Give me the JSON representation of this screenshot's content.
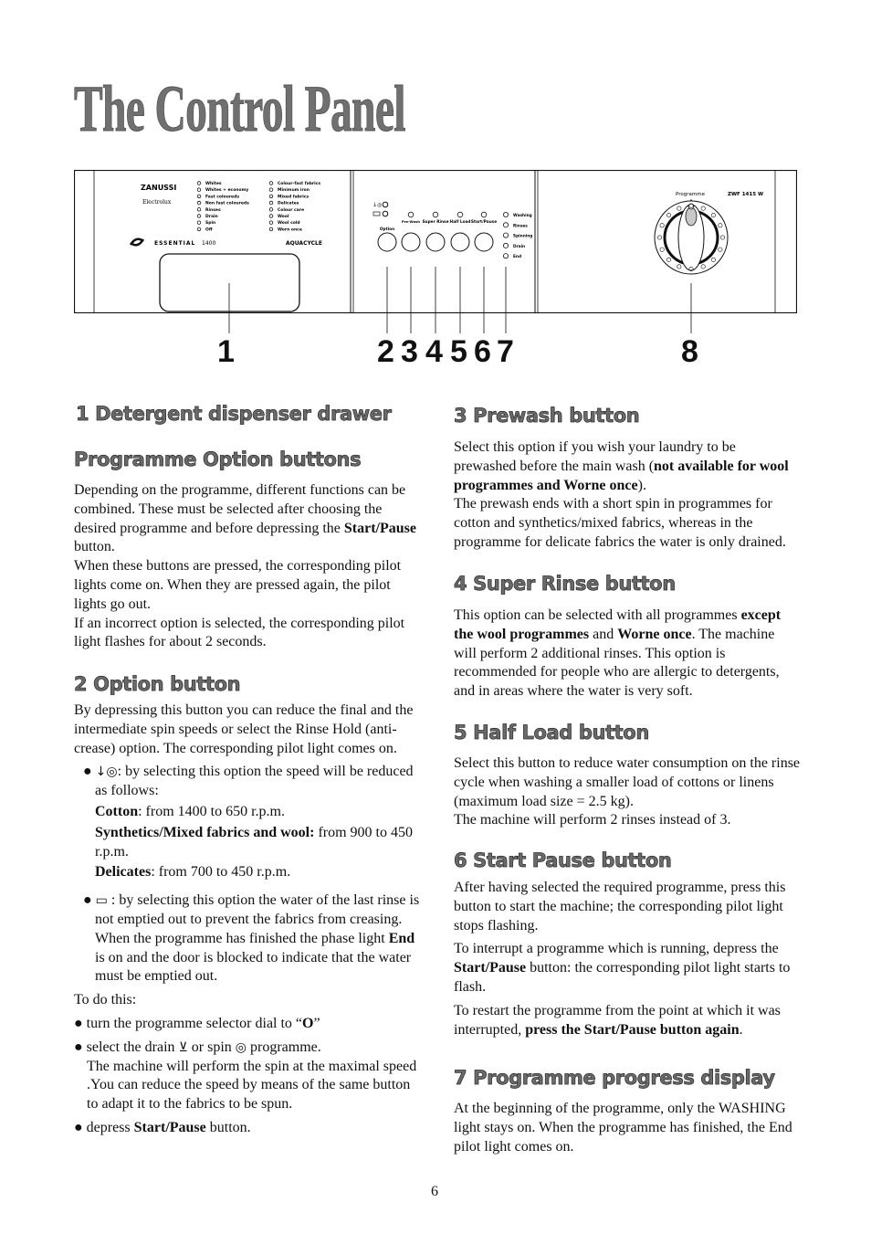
{
  "title": "The Control Panel",
  "panel": {
    "brand": "ZANUSSI",
    "sub_brand": "Electrolux",
    "series": "ESSENTIAL",
    "speed": "1400",
    "aquacycle": "AQUACYCLE",
    "programmes_left": [
      "Whites",
      "Whites + economy",
      "Fast coloureds",
      "Non fast coloureds",
      "Rinses",
      "Drain",
      "Spin",
      "Off"
    ],
    "programmes_right": [
      "Colour-fast fabrics",
      "Minimum iron",
      "Mixed fabrics",
      "Delicates",
      "Colour care",
      "Wool",
      "Wool cold",
      "Worn once"
    ],
    "buttons": [
      "Option",
      "Pre-Wash",
      "Super Rinse",
      "Half Load",
      "Start/Pause"
    ],
    "phases": [
      "Washing",
      "Rinses",
      "Spinning",
      "Drain",
      "End"
    ],
    "dial_label": "Programme",
    "model": "ZWF 1415 W",
    "dial_pointer_color": "#c8c8c8"
  },
  "callouts": [
    "1",
    "2",
    "3",
    "4",
    "5",
    "6",
    "7",
    "8"
  ],
  "left": {
    "h1": "1 Detergent dispenser drawer",
    "h2": "Programme Option buttons",
    "p_options": [
      [
        {
          "t": "Depending on the programme, different functions can be combined. These must be selected after choosing the desired programme and before depressing the "
        },
        {
          "t": "Start/Pause",
          "b": 1
        },
        {
          "t": " button."
        }
      ],
      [
        {
          "t": "When these buttons are pressed, the corresponding pilot lights come on. When they are pressed again, the pilot lights go out."
        }
      ],
      [
        {
          "t": "If an incorrect option is selected, the corresponding pilot light flashes for about 2 seconds."
        }
      ]
    ],
    "h3": "2 Option button",
    "p_option": [
      [
        {
          "t": "By depressing this button you can reduce the final and the intermediate spin speeds or select the Rinse Hold (anti-crease) option. The corresponding pilot light comes on."
        }
      ]
    ],
    "bullet_speed": [
      {
        "icon": "reduced-spin-icon",
        "g": "↓◎"
      },
      {
        "t": ": by selecting this option the speed will be reduced as follows:"
      }
    ],
    "speed_lines": [
      [
        {
          "t": "Cotton",
          "b": 1
        },
        {
          "t": ": from 1400 to 650 r.p.m."
        }
      ],
      [
        {
          "t": "Synthetics/Mixed fabrics and wool:",
          "b": 1
        },
        {
          "t": " from 900 to 450 r.p.m."
        }
      ],
      [
        {
          "t": "Delicates",
          "b": 1
        },
        {
          "t": ": from 700 to 450 r.p.m."
        }
      ]
    ],
    "bullet_rinse": [
      {
        "icon": "rinse-hold-icon",
        "g": "▭"
      },
      {
        "t": " : by selecting this option the water of the last rinse is not emptied out to prevent the fabrics from creasing. When the programme has finished the phase light "
      },
      {
        "t": "End",
        "b": 1
      },
      {
        "t": " is on and the door is blocked to indicate that the water must be emptied out."
      }
    ],
    "to_do": "To do this:",
    "steps": [
      [
        {
          "t": "turn the programme selector dial to “"
        },
        {
          "t": "O",
          "b": 1
        },
        {
          "t": "”"
        }
      ],
      [
        {
          "t": "select the drain "
        },
        {
          "icon": "drain-icon",
          "g": "⊻"
        },
        {
          "t": " or spin "
        },
        {
          "icon": "spin-icon",
          "g": "◎"
        },
        {
          "t": " programme."
        }
      ],
      [
        {
          "t": "depress "
        },
        {
          "t": "Start/Pause",
          "b": 1
        },
        {
          "t": " button."
        }
      ]
    ],
    "step2_extra": "The machine will perform the spin at the maximal speed .You can reduce the speed by means of the same button to adapt it to the fabrics to be spun."
  },
  "right": {
    "h_prewash": "3 Prewash button",
    "p_prewash": [
      [
        {
          "t": "Select this option if you wish your laundry to be prewashed before the main wash ("
        },
        {
          "t": "not available for wool programmes and Worne once",
          "b": 1
        },
        {
          "t": ")."
        }
      ],
      [
        {
          "t": "The prewash ends with a short spin in programmes for cotton and synthetics/mixed fabrics, whereas in the programme for delicate fabrics the water is only drained."
        }
      ]
    ],
    "h_rinse": "4 Super Rinse button",
    "p_rinse": [
      [
        {
          "t": "This option can be selected with all programmes "
        },
        {
          "t": "except the wool programmes",
          "b": 1
        },
        {
          "t": " and "
        },
        {
          "t": "Worne once",
          "b": 1
        },
        {
          "t": ". The machine will perform 2 additional rinses. This option is recommended for people who are allergic to detergents, and in areas where the water is very soft."
        }
      ]
    ],
    "h_half": "5 Half Load button",
    "p_half": [
      [
        {
          "t": "Select this button to reduce water consumption on the rinse cycle when washing a smaller load of cottons or linens (maximum load size = 2.5 kg)."
        }
      ],
      [
        {
          "t": "The machine will perform 2 rinses instead of 3."
        }
      ]
    ],
    "h_start": "6 Start Pause button",
    "p_start": [
      [
        {
          "t": "After having selected the required programme, press this button to start the machine; the corresponding pilot light stops flashing."
        }
      ],
      [
        {
          "t": "To interrupt a programme which is running, depress the "
        },
        {
          "t": "Start/Pause",
          "b": 1
        },
        {
          "t": " button: the corresponding pilot light starts to flash."
        }
      ],
      [
        {
          "t": "To restart the programme from the point at which it was interrupted, "
        },
        {
          "t": "press the Start/Pause button again",
          "b": 1
        },
        {
          "t": "."
        }
      ]
    ],
    "h_progress": "7 Programme progress display",
    "p_progress": [
      [
        {
          "t": "At the beginning of the programme, only the WASHING light stays on. When the programme has finished, the End pilot light comes on."
        }
      ]
    ]
  },
  "page_number": "6"
}
